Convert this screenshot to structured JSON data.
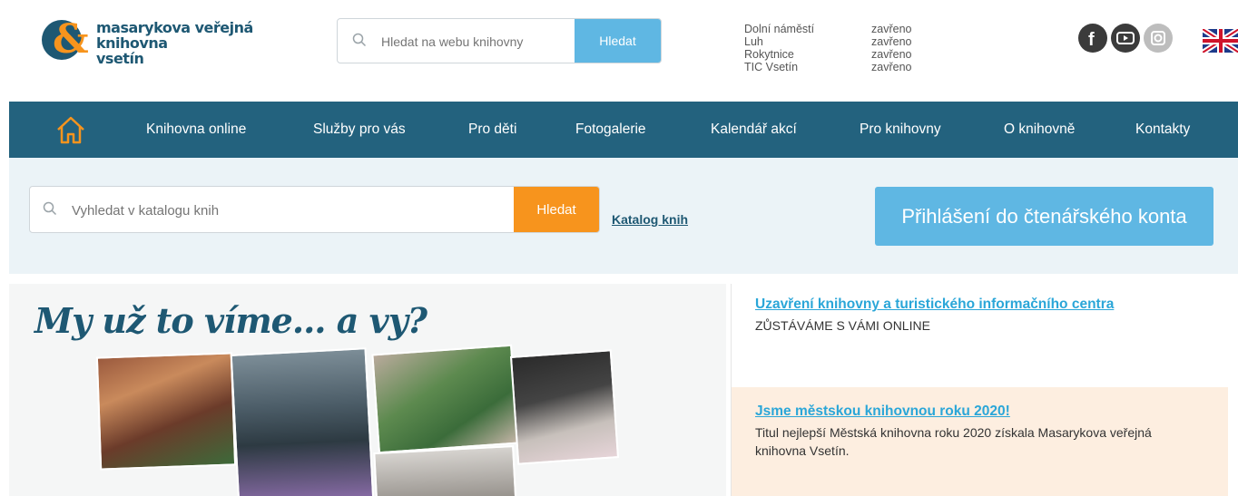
{
  "header": {
    "logo": {
      "line1": "masarykova veřejná knihovna",
      "line2": "vsetín"
    },
    "web_search": {
      "placeholder": "Hledat na webu knihovny",
      "button": "Hledat"
    },
    "hours": [
      {
        "place": "Dolní náměstí",
        "state": "zavřeno"
      },
      {
        "place": "Luh",
        "state": "zavřeno"
      },
      {
        "place": "Rokytnice",
        "state": "zavřeno"
      },
      {
        "place": "TIC Vsetín",
        "state": "zavřeno"
      }
    ],
    "socials": [
      "facebook-icon",
      "youtube-icon",
      "instagram-icon"
    ],
    "language_flag": "uk-flag-icon"
  },
  "nav": {
    "home_icon": "home-icon",
    "items": [
      "Knihovna online",
      "Služby pro vás",
      "Pro děti",
      "Fotogalerie",
      "Kalendář akcí",
      "Pro knihovny",
      "O knihovně",
      "Kontakty"
    ]
  },
  "catalog": {
    "placeholder": "Vyhledat v katalogu knih",
    "button": "Hledat",
    "link": "Katalog knih",
    "login": "Přihlášení do čtenářského konta"
  },
  "hero": {
    "title": "My už to víme... a vy?"
  },
  "news": [
    {
      "title": "Uzavření knihovny a turistického informačního centra",
      "text": "ZŮSTÁVÁME S VÁMI ONLINE"
    },
    {
      "title": "Jsme městskou knihovnou roku 2020!",
      "text": "Titul nejlepší Městská knihovna roku 2020 získala Masarykova veřejná knihovna Vsetín."
    }
  ],
  "colors": {
    "brand": "#1e5873",
    "nav": "#23627e",
    "accent_blue": "#5fb7e3",
    "accent_orange": "#f7941d",
    "news_highlight": "#fdeee0"
  }
}
